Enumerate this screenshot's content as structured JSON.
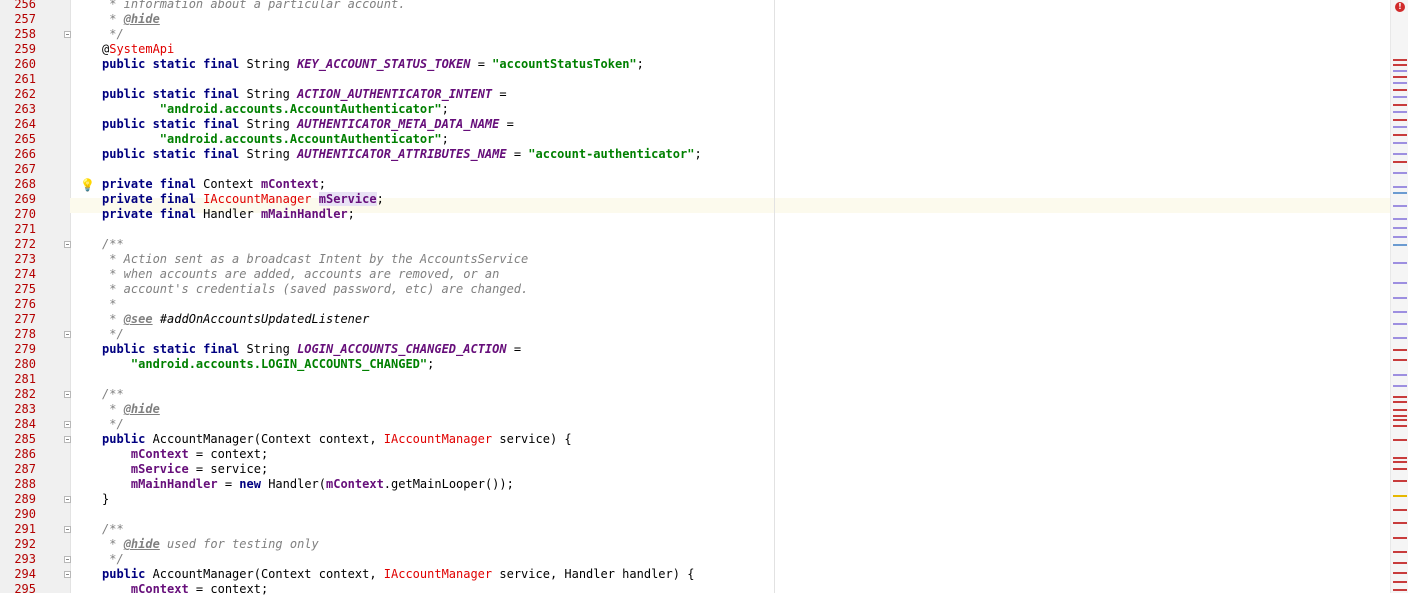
{
  "editor": {
    "lines": [
      {
        "n": "256",
        "tokens": [
          [
            "cm",
            " * information about a particular account."
          ]
        ]
      },
      {
        "n": "257",
        "tokens": [
          [
            "cm",
            " * "
          ],
          [
            "tag",
            "@hide"
          ]
        ]
      },
      {
        "n": "258",
        "fold": true,
        "tokens": [
          [
            "cm",
            " */"
          ]
        ]
      },
      {
        "n": "259",
        "tokens": [
          [
            "pln",
            "@"
          ],
          [
            "err",
            "SystemApi"
          ]
        ]
      },
      {
        "n": "260",
        "tokens": [
          [
            "kw",
            "public static final "
          ],
          [
            "pln",
            "String "
          ],
          [
            "cst",
            "KEY_ACCOUNT_STATUS_TOKEN"
          ],
          [
            "pln",
            " = "
          ],
          [
            "str",
            "\"accountStatusToken\""
          ],
          [
            "pln",
            ";"
          ]
        ]
      },
      {
        "n": "261",
        "tokens": []
      },
      {
        "n": "262",
        "tokens": [
          [
            "kw",
            "public static final "
          ],
          [
            "pln",
            "String "
          ],
          [
            "cst",
            "ACTION_AUTHENTICATOR_INTENT"
          ],
          [
            "pln",
            " ="
          ]
        ]
      },
      {
        "n": "263",
        "tokens": [
          [
            "pln",
            "        "
          ],
          [
            "str",
            "\"android.accounts.AccountAuthenticator\""
          ],
          [
            "pln",
            ";"
          ]
        ]
      },
      {
        "n": "264",
        "tokens": [
          [
            "kw",
            "public static final "
          ],
          [
            "pln",
            "String "
          ],
          [
            "cst",
            "AUTHENTICATOR_META_DATA_NAME"
          ],
          [
            "pln",
            " ="
          ]
        ]
      },
      {
        "n": "265",
        "tokens": [
          [
            "pln",
            "        "
          ],
          [
            "str",
            "\"android.accounts.AccountAuthenticator\""
          ],
          [
            "pln",
            ";"
          ]
        ]
      },
      {
        "n": "266",
        "tokens": [
          [
            "kw",
            "public static final "
          ],
          [
            "pln",
            "String "
          ],
          [
            "cst",
            "AUTHENTICATOR_ATTRIBUTES_NAME"
          ],
          [
            "pln",
            " = "
          ],
          [
            "str",
            "\"account-authenticator\""
          ],
          [
            "pln",
            ";"
          ]
        ]
      },
      {
        "n": "267",
        "tokens": []
      },
      {
        "n": "268",
        "bulb": true,
        "tokens": [
          [
            "kw",
            "private final "
          ],
          [
            "pln",
            "Context "
          ],
          [
            "fld",
            "mContext"
          ],
          [
            "pln",
            ";"
          ]
        ]
      },
      {
        "n": "269",
        "tokens": [
          [
            "kw",
            "private final "
          ],
          [
            "err",
            "IAccountManager"
          ],
          [
            "pln",
            " "
          ],
          [
            "fld-hl",
            "mService"
          ],
          [
            "pln",
            ";"
          ]
        ]
      },
      {
        "n": "270",
        "tokens": [
          [
            "kw",
            "private final "
          ],
          [
            "pln",
            "Handler "
          ],
          [
            "fld",
            "mMainHandler"
          ],
          [
            "pln",
            ";"
          ]
        ]
      },
      {
        "n": "271",
        "tokens": []
      },
      {
        "n": "272",
        "fold": true,
        "tokens": [
          [
            "cm",
            "/**"
          ]
        ]
      },
      {
        "n": "273",
        "tokens": [
          [
            "cm",
            " * Action sent as a broadcast Intent by the AccountsService"
          ]
        ]
      },
      {
        "n": "274",
        "tokens": [
          [
            "cm",
            " * when accounts are added, accounts are removed, or an"
          ]
        ]
      },
      {
        "n": "275",
        "tokens": [
          [
            "cm",
            " * account's credentials (saved password, etc) are changed."
          ]
        ]
      },
      {
        "n": "276",
        "tokens": [
          [
            "cm",
            " *"
          ]
        ]
      },
      {
        "n": "277",
        "tokens": [
          [
            "cm",
            " * "
          ],
          [
            "tag",
            "@see"
          ],
          [
            "cm",
            " "
          ],
          [
            "tag-ref",
            "#addOnAccountsUpdatedListener"
          ]
        ]
      },
      {
        "n": "278",
        "fold": true,
        "tokens": [
          [
            "cm",
            " */"
          ]
        ]
      },
      {
        "n": "279",
        "tokens": [
          [
            "kw",
            "public static final "
          ],
          [
            "pln",
            "String "
          ],
          [
            "cst",
            "LOGIN_ACCOUNTS_CHANGED_ACTION"
          ],
          [
            "pln",
            " ="
          ]
        ]
      },
      {
        "n": "280",
        "tokens": [
          [
            "pln",
            "    "
          ],
          [
            "str",
            "\"android.accounts.LOGIN_ACCOUNTS_CHANGED\""
          ],
          [
            "pln",
            ";"
          ]
        ]
      },
      {
        "n": "281",
        "tokens": []
      },
      {
        "n": "282",
        "fold": true,
        "tokens": [
          [
            "cm",
            "/**"
          ]
        ]
      },
      {
        "n": "283",
        "tokens": [
          [
            "cm",
            " * "
          ],
          [
            "tag",
            "@hide"
          ]
        ]
      },
      {
        "n": "284",
        "fold": true,
        "tokens": [
          [
            "cm",
            " */"
          ]
        ]
      },
      {
        "n": "285",
        "fold": true,
        "tokens": [
          [
            "kw",
            "public "
          ],
          [
            "pln",
            "AccountManager(Context context, "
          ],
          [
            "err",
            "IAccountManager"
          ],
          [
            "pln",
            " service) {"
          ]
        ]
      },
      {
        "n": "286",
        "tokens": [
          [
            "pln",
            "    "
          ],
          [
            "fld",
            "mContext"
          ],
          [
            "pln",
            " = context;"
          ]
        ]
      },
      {
        "n": "287",
        "tokens": [
          [
            "pln",
            "    "
          ],
          [
            "fld",
            "mService"
          ],
          [
            "pln",
            " = service;"
          ]
        ]
      },
      {
        "n": "288",
        "tokens": [
          [
            "pln",
            "    "
          ],
          [
            "fld",
            "mMainHandler"
          ],
          [
            "pln",
            " = "
          ],
          [
            "kw",
            "new "
          ],
          [
            "pln",
            "Handler("
          ],
          [
            "fld",
            "mContext"
          ],
          [
            "pln",
            ".getMainLooper());"
          ]
        ]
      },
      {
        "n": "289",
        "fold": true,
        "tokens": [
          [
            "pln",
            "}"
          ]
        ]
      },
      {
        "n": "290",
        "tokens": []
      },
      {
        "n": "291",
        "fold": true,
        "tokens": [
          [
            "cm",
            "/**"
          ]
        ]
      },
      {
        "n": "292",
        "tokens": [
          [
            "cm",
            " * "
          ],
          [
            "tag",
            "@hide"
          ],
          [
            "cm",
            " used for testing only"
          ]
        ]
      },
      {
        "n": "293",
        "fold": true,
        "tokens": [
          [
            "cm",
            " */"
          ]
        ]
      },
      {
        "n": "294",
        "fold": true,
        "tokens": [
          [
            "kw",
            "public "
          ],
          [
            "pln",
            "AccountManager(Context context, "
          ],
          [
            "err",
            "IAccountManager"
          ],
          [
            "pln",
            " service, Handler handler) {"
          ]
        ]
      },
      {
        "n": "295",
        "tokens": [
          [
            "pln",
            "    "
          ],
          [
            "fld",
            "mContext"
          ],
          [
            "pln",
            " = context;"
          ]
        ]
      }
    ]
  },
  "error_stripe": {
    "indicator_label": "!",
    "colors": {
      "error": "#c83c3c",
      "warning": "#e6b800",
      "info": "#9d8fe0",
      "usage": "#6b9bd1"
    },
    "marks": [
      {
        "pos": 0.099,
        "kind": "error"
      },
      {
        "pos": 0.108,
        "kind": "error"
      },
      {
        "pos": 0.118,
        "kind": "info"
      },
      {
        "pos": 0.128,
        "kind": "error"
      },
      {
        "pos": 0.138,
        "kind": "info"
      },
      {
        "pos": 0.15,
        "kind": "error"
      },
      {
        "pos": 0.162,
        "kind": "info"
      },
      {
        "pos": 0.175,
        "kind": "error"
      },
      {
        "pos": 0.188,
        "kind": "info"
      },
      {
        "pos": 0.2,
        "kind": "error"
      },
      {
        "pos": 0.213,
        "kind": "info"
      },
      {
        "pos": 0.226,
        "kind": "error"
      },
      {
        "pos": 0.24,
        "kind": "info"
      },
      {
        "pos": 0.258,
        "kind": "info"
      },
      {
        "pos": 0.272,
        "kind": "error"
      },
      {
        "pos": 0.29,
        "kind": "info"
      },
      {
        "pos": 0.313,
        "kind": "info"
      },
      {
        "pos": 0.323,
        "kind": "usage"
      },
      {
        "pos": 0.345,
        "kind": "info"
      },
      {
        "pos": 0.367,
        "kind": "info"
      },
      {
        "pos": 0.383,
        "kind": "info"
      },
      {
        "pos": 0.398,
        "kind": "info"
      },
      {
        "pos": 0.412,
        "kind": "usage"
      },
      {
        "pos": 0.441,
        "kind": "info"
      },
      {
        "pos": 0.475,
        "kind": "info"
      },
      {
        "pos": 0.5,
        "kind": "info"
      },
      {
        "pos": 0.525,
        "kind": "info"
      },
      {
        "pos": 0.545,
        "kind": "info"
      },
      {
        "pos": 0.568,
        "kind": "info"
      },
      {
        "pos": 0.589,
        "kind": "error"
      },
      {
        "pos": 0.606,
        "kind": "error"
      },
      {
        "pos": 0.63,
        "kind": "info"
      },
      {
        "pos": 0.65,
        "kind": "info"
      },
      {
        "pos": 0.668,
        "kind": "error"
      },
      {
        "pos": 0.676,
        "kind": "error"
      },
      {
        "pos": 0.69,
        "kind": "error"
      },
      {
        "pos": 0.699,
        "kind": "error"
      },
      {
        "pos": 0.707,
        "kind": "error"
      },
      {
        "pos": 0.717,
        "kind": "error"
      },
      {
        "pos": 0.74,
        "kind": "error"
      },
      {
        "pos": 0.77,
        "kind": "error"
      },
      {
        "pos": 0.777,
        "kind": "error"
      },
      {
        "pos": 0.79,
        "kind": "error"
      },
      {
        "pos": 0.81,
        "kind": "error"
      },
      {
        "pos": 0.834,
        "kind": "warning"
      },
      {
        "pos": 0.858,
        "kind": "error"
      },
      {
        "pos": 0.88,
        "kind": "error"
      },
      {
        "pos": 0.905,
        "kind": "error"
      },
      {
        "pos": 0.93,
        "kind": "error"
      },
      {
        "pos": 0.948,
        "kind": "error"
      },
      {
        "pos": 0.965,
        "kind": "error"
      },
      {
        "pos": 0.98,
        "kind": "error"
      },
      {
        "pos": 0.993,
        "kind": "error"
      }
    ]
  }
}
